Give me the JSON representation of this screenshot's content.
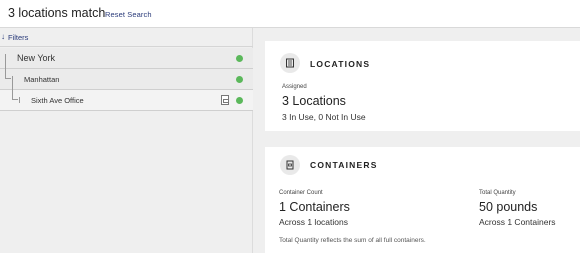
{
  "header": {
    "title": "3 locations match",
    "reset_label": "Reset Search"
  },
  "filters": {
    "label": "Filters"
  },
  "tree": [
    {
      "label": "New York",
      "status": "in-use"
    },
    {
      "label": "Manhattan",
      "status": "in-use"
    },
    {
      "label": "Sixth Ave Office",
      "status": "in-use"
    }
  ],
  "locations_card": {
    "title": "LOCATIONS",
    "assigned_label": "Assigned",
    "assigned_value": "3 Locations",
    "usage": "3 In Use, 0 Not In Use"
  },
  "containers_card": {
    "title": "CONTAINERS",
    "count_label": "Container Count",
    "count_value": "1 Containers",
    "count_sub": "Across 1 locations",
    "qty_label": "Total Quantity",
    "qty_value": "50 pounds",
    "qty_sub": "Across 1 Containers",
    "note": "Total Quantity reflects the sum of all full containers."
  },
  "colors": {
    "status_green": "#5bb85b",
    "link_blue": "#2a3b7a"
  }
}
